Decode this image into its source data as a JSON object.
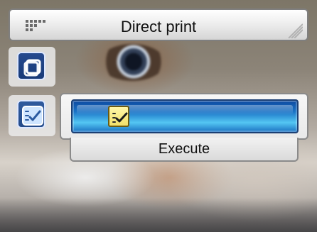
{
  "title": "Direct print",
  "action": {
    "execute_label": "Execute"
  },
  "icons": {
    "menu_dots": "dots-grid-icon",
    "copies": "copies-icon",
    "checklist": "checklist-icon",
    "selected_check": "checkmark-icon"
  },
  "colors": {
    "panel_bg": "#e9e9e9",
    "panel_border": "#8a8a8a",
    "accent_blue": "#1a73c6",
    "accent_cyan": "#54c6f3",
    "check_yellow": "#f1e06a"
  }
}
